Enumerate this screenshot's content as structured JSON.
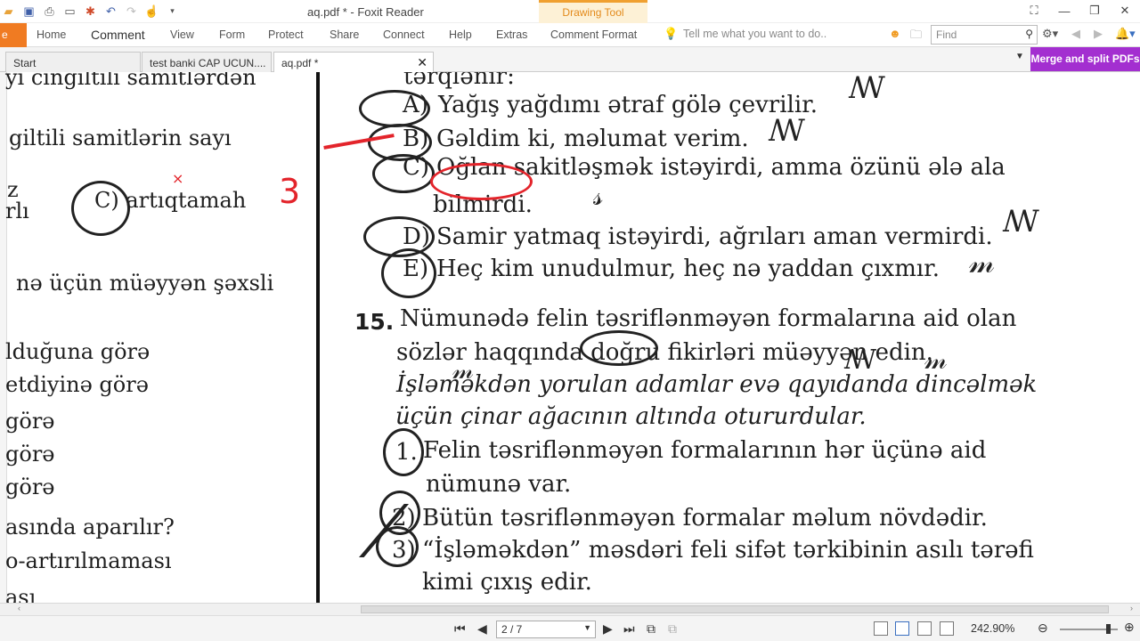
{
  "window": {
    "title": "aq.pdf * - Foxit Reader",
    "context_tab": "Drawing Tool"
  },
  "menu": {
    "file": "e",
    "items": [
      "Home",
      "Comment",
      "View",
      "Form",
      "Protect",
      "Share",
      "Connect",
      "Help",
      "Extras",
      "Comment Format"
    ],
    "active": "Comment",
    "tell_me": "Tell me what you want to do..",
    "find_placeholder": "Find"
  },
  "tabs": [
    {
      "label": "Start"
    },
    {
      "label": "test banki CAP UCUN...."
    },
    {
      "label": "aq.pdf *"
    }
  ],
  "merge_button": "Merge and split PDFs",
  "document": {
    "left_column": [
      "yı cingiltili samitlərdən",
      "giltili samitlərin sayı",
      "z",
      "rlı",
      "C) artıqtamah",
      "nə üçün müəyyən şəxsli",
      "lduğuna görə",
      "etdiyinə görə",
      "görə",
      "görə",
      "görə",
      "asında aparılır?",
      "o-artırılmaması",
      "ası"
    ],
    "left_red_mark": "3",
    "right_column": {
      "top_line": "tərqlənir:",
      "options": [
        {
          "letter": "A)",
          "text": "Yağış yağdımı ətraf gölə çevrilir."
        },
        {
          "letter": "B)",
          "text": "Gəldim ki, məlumat verim."
        },
        {
          "letter": "C)",
          "text": "Oğlan sakitləşmək istəyirdi, amma özünü ələ ala"
        },
        {
          "letter": "",
          "text": "bilmirdi."
        },
        {
          "letter": "D)",
          "text": "Samir yatmaq istəyirdi, ağrıları aman vermirdi."
        },
        {
          "letter": "E)",
          "text": "Heç kim unudulmur, heç nə yaddan çıxmır."
        }
      ],
      "question_number": "15.",
      "question_lines": [
        "Nümunədə felin təsriflənməyən formalarına aid olan",
        "sözlər haqqında doğru fikirləri müəyyən edin."
      ],
      "example_lines": [
        "İşləməkdən yorulan adamlar evə qayıdanda dincəlmək",
        "üçün çinar ağacının altında otururdular."
      ],
      "statements": [
        {
          "num": "1.",
          "text": "Felin təsriflənməyən formalarının hər üçünə aid"
        },
        {
          "num": "",
          "text": "nümunə var."
        },
        {
          "num": "2)",
          "text": "Bütün təsriflənməyən formalar məlum növdədir."
        },
        {
          "num": "3)",
          "text": "“İşləməkdən” məsdəri feli sifət tərkibinin asılı tərəfi"
        },
        {
          "num": "",
          "text": "kimi çıxış edir."
        }
      ]
    }
  },
  "status": {
    "page": "2 / 7",
    "zoom": "242.90%"
  }
}
